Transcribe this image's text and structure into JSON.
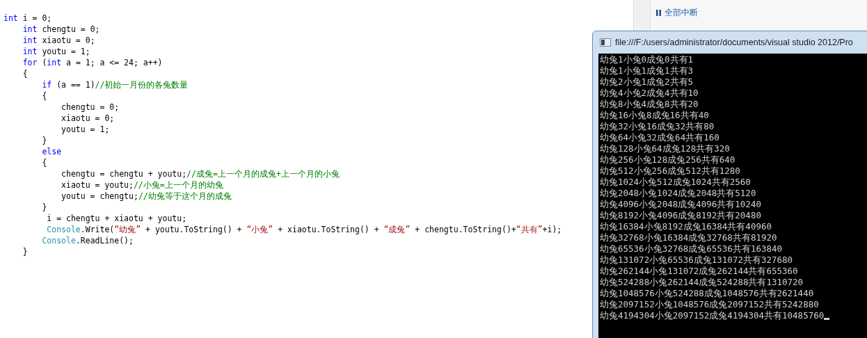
{
  "editor": {
    "lines": [
      {
        "tokens": [
          {
            "kind": "keyword",
            "text": "int"
          },
          {
            "kind": "plain",
            "text": " i = 0;"
          }
        ]
      },
      {
        "tokens": [
          {
            "kind": "keyword",
            "text": "    int"
          },
          {
            "kind": "plain",
            "text": " chengtu = 0;"
          }
        ]
      },
      {
        "tokens": [
          {
            "kind": "keyword",
            "text": "    int"
          },
          {
            "kind": "plain",
            "text": " xiaotu = 0;"
          }
        ]
      },
      {
        "tokens": [
          {
            "kind": "keyword",
            "text": "    int"
          },
          {
            "kind": "plain",
            "text": " youtu = 1;"
          }
        ]
      },
      {
        "tokens": [
          {
            "kind": "keyword",
            "text": "    for"
          },
          {
            "kind": "plain",
            "text": " ("
          },
          {
            "kind": "keyword",
            "text": "int"
          },
          {
            "kind": "plain",
            "text": " a = 1; a <= 24; a++)"
          }
        ]
      },
      {
        "tokens": [
          {
            "kind": "plain",
            "text": "    {"
          }
        ]
      },
      {
        "tokens": [
          {
            "kind": "keyword",
            "text": "        if"
          },
          {
            "kind": "plain",
            "text": " (a == 1)"
          },
          {
            "kind": "comment",
            "text": "//初始一月份的各兔数量"
          }
        ]
      },
      {
        "tokens": [
          {
            "kind": "plain",
            "text": "        {"
          }
        ]
      },
      {
        "tokens": [
          {
            "kind": "plain",
            "text": "            chengtu = 0;"
          }
        ]
      },
      {
        "tokens": [
          {
            "kind": "plain",
            "text": "            xiaotu = 0;"
          }
        ]
      },
      {
        "tokens": [
          {
            "kind": "plain",
            "text": "            youtu = 1;"
          }
        ]
      },
      {
        "tokens": [
          {
            "kind": "plain",
            "text": "        }"
          }
        ]
      },
      {
        "tokens": [
          {
            "kind": "keyword",
            "text": "        else"
          }
        ]
      },
      {
        "tokens": [
          {
            "kind": "plain",
            "text": "        {"
          }
        ]
      },
      {
        "tokens": [
          {
            "kind": "plain",
            "text": "            chengtu = chengtu + youtu;"
          },
          {
            "kind": "comment",
            "text": "//成兔=上一个月的成兔+上一个月的小兔"
          }
        ]
      },
      {
        "tokens": [
          {
            "kind": "plain",
            "text": "            xiaotu = youtu;"
          },
          {
            "kind": "comment",
            "text": "//小兔=上一个月的幼兔"
          }
        ]
      },
      {
        "tokens": [
          {
            "kind": "plain",
            "text": "            youtu = chengtu;"
          },
          {
            "kind": "comment",
            "text": "//幼兔等于这个月的成兔"
          }
        ]
      },
      {
        "tokens": [
          {
            "kind": "plain",
            "text": "        }"
          }
        ]
      },
      {
        "tokens": [
          {
            "kind": "plain",
            "text": "         i = chengtu + xiaotu + youtu;"
          }
        ]
      },
      {
        "tokens": [
          {
            "kind": "type",
            "text": "         Console"
          },
          {
            "kind": "plain",
            "text": ".Write("
          },
          {
            "kind": "string",
            "text": "“幼兔”"
          },
          {
            "kind": "plain",
            "text": " + youtu.ToString() + "
          },
          {
            "kind": "string",
            "text": "“小兔”"
          },
          {
            "kind": "plain",
            "text": " + xiaotu.ToString() + "
          },
          {
            "kind": "string",
            "text": "“成兔”"
          },
          {
            "kind": "plain",
            "text": " + chengtu.ToString()+"
          },
          {
            "kind": "string",
            "text": "“共有”"
          },
          {
            "kind": "plain",
            "text": "+i);"
          }
        ]
      },
      {
        "tokens": [
          {
            "kind": "type",
            "text": "        Console"
          },
          {
            "kind": "plain",
            "text": ".ReadLine();"
          }
        ]
      },
      {
        "tokens": [
          {
            "kind": "plain",
            "text": "    }"
          }
        ]
      }
    ]
  },
  "toolbar": {
    "break_all_button": "全部中断"
  },
  "console": {
    "title": "file:///F:/users/administrator/documents/visual studio 2012/Pro",
    "lines": [
      "幼兔1小兔0成兔0共有1",
      "幼兔1小兔1成兔1共有3",
      "幼兔2小兔1成兔2共有5",
      "幼兔4小兔2成兔4共有10",
      "幼兔8小兔4成兔8共有20",
      "幼兔16小兔8成兔16共有40",
      "幼兔32小兔16成兔32共有80",
      "幼兔64小兔32成兔64共有160",
      "幼兔128小兔64成兔128共有320",
      "幼兔256小兔128成兔256共有640",
      "幼兔512小兔256成兔512共有1280",
      "幼兔1024小兔512成兔1024共有2560",
      "幼兔2048小兔1024成兔2048共有5120",
      "幼兔4096小兔2048成兔4096共有10240",
      "幼兔8192小兔4096成兔8192共有20480",
      "幼兔16384小兔8192成兔16384共有40960",
      "幼兔32768小兔16384成兔32768共有81920",
      "幼兔65536小兔32768成兔65536共有163840",
      "幼兔131072小兔65536成兔131072共有327680",
      "幼兔262144小兔131072成兔262144共有655360",
      "幼兔524288小兔262144成兔524288共有1310720",
      "幼兔1048576小兔524288成兔1048576共有2621440",
      "幼兔2097152小兔1048576成兔2097152共有5242880",
      "幼兔4194304小兔2097152成兔4194304共有10485760"
    ]
  }
}
